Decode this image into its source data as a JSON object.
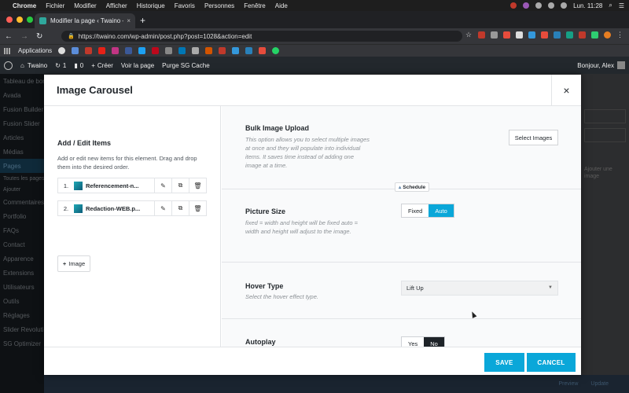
{
  "macos": {
    "app": "Chrome",
    "menus": [
      "Fichier",
      "Modifier",
      "Afficher",
      "Historique",
      "Favoris",
      "Personnes",
      "Fenêtre",
      "Aide"
    ],
    "clock": "Lun. 11:28"
  },
  "browser": {
    "tab_title": "Modifier la page ‹ Twaino — W",
    "url": "https://twaino.com/wp-admin/post.php?post=1028&action=edit",
    "bookmarks_label": "Applications"
  },
  "wp_admin_bar": {
    "site": "Twaino",
    "updates": "1",
    "comments": "0",
    "new": "Créer",
    "view": "Voir la page",
    "purge": "Purge SG Cache",
    "greeting": "Bonjour, Alex"
  },
  "wp_sidebar": [
    "Tableau de bord",
    "Avada",
    "Fusion Builder",
    "Fusion Slider",
    "Articles",
    "Médias",
    "Pages",
    "Toutes les pages",
    "Ajouter",
    "Commentaires",
    "Portfolio",
    "FAQs",
    "Contact",
    "Apparence",
    "Extensions",
    "Utilisateurs",
    "Outils",
    "Réglages",
    "Slider Revolution",
    "SG Optimizer"
  ],
  "wp_background": {
    "right_note": "Ajouter une image",
    "bottom_left": "Preview",
    "bottom_right": "Update"
  },
  "modal": {
    "title": "Image Carousel",
    "close_icon": "×",
    "left": {
      "heading": "Add / Edit Items",
      "description": "Add or edit new items for this element. Drag and drop them into the desired order.",
      "items": [
        {
          "num": "1.",
          "name": "Referencement-n..."
        },
        {
          "num": "2.",
          "name": "Redaction-WEB.p..."
        }
      ],
      "add_button": "Image"
    },
    "options": {
      "bulk": {
        "label": "Bulk Image Upload",
        "desc": "This option allows you to select multiple images at once and they will populate into individual items. It saves time instead of adding one image at a time.",
        "button": "Select Images"
      },
      "picture_size": {
        "label": "Picture Size",
        "desc": "fixed = width and height will be fixed auto = width and height will adjust to the image.",
        "options": [
          "Fixed",
          "Auto"
        ],
        "selected": "Auto"
      },
      "schedule": "Schedule",
      "hover": {
        "label": "Hover Type",
        "desc": "Select the hover effect type.",
        "value": "Lift Up"
      },
      "autoplay": {
        "label": "Autoplay",
        "options": [
          "Yes",
          "No"
        ],
        "selected": "No"
      }
    },
    "footer": {
      "save": "SAVE",
      "cancel": "CANCEL"
    }
  },
  "colors": {
    "accent": "#0aa7d9",
    "wp_bar": "#23282d"
  }
}
